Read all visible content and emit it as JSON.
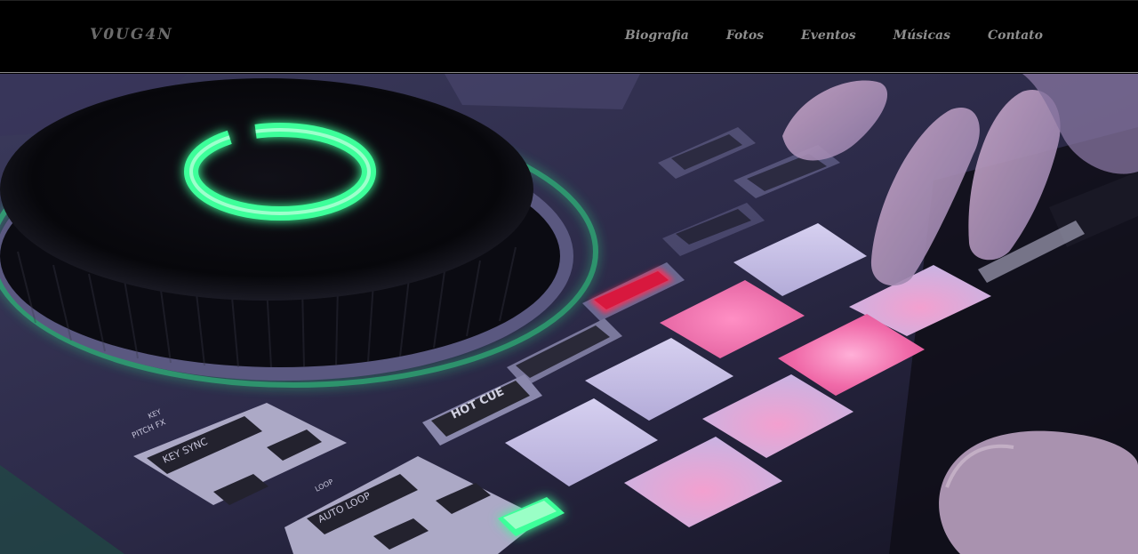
{
  "header": {
    "logo": "V0UG4N",
    "nav": [
      {
        "label": "Biografia"
      },
      {
        "label": "Fotos"
      },
      {
        "label": "Eventos"
      },
      {
        "label": "Músicas"
      },
      {
        "label": "Contato"
      }
    ]
  },
  "hero": {
    "controller_labels": {
      "hot_cue": "HOT CUE",
      "loop": "LOOP",
      "key_sync": "KEY SYNC",
      "auto_loop": "AUTO LOOP",
      "key": "KEY",
      "pitch_fx": "PITCH FX"
    }
  },
  "colors": {
    "header_bg": "#000000",
    "nav_text": "#8e8e8e",
    "logo_text": "#6b6b6b",
    "jog_glow": "#3dff9a",
    "pad_pink": "#f06aa8",
    "pad_light": "#c9c2e8"
  }
}
